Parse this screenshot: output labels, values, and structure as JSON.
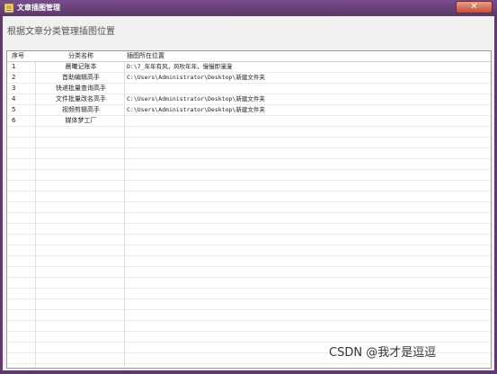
{
  "window": {
    "title": "文章插图管理",
    "close_glyph": "✕"
  },
  "header": {
    "label": "根据文章分类管理插图位置"
  },
  "table": {
    "columns": [
      "序号",
      "分类名称",
      "插图所在位置"
    ],
    "rows": [
      {
        "index": "1",
        "name": "晨曦记账本",
        "path": "D:\\7_年年有风，风吹年年，慢慢即漫漫"
      },
      {
        "index": "2",
        "name": "首助编辑高手",
        "path": "C:\\Users\\Administrator\\Desktop\\新建文件夹"
      },
      {
        "index": "3",
        "name": "快递批量查询高手",
        "path": ""
      },
      {
        "index": "4",
        "name": "文件批量改名高手",
        "path": "C:\\Users\\Administrator\\Desktop\\新建文件夹"
      },
      {
        "index": "5",
        "name": "视频剪辑高手",
        "path": "C:\\Users\\Administrator\\Desktop\\新建文件夹"
      },
      {
        "index": "6",
        "name": "媒体梦工厂",
        "path": ""
      }
    ]
  },
  "watermark": "CSDN @我才是逗逗",
  "colors": {
    "titlebar": "#6a4179",
    "close_button": "#c44b34",
    "grid_line": "#ececec"
  }
}
